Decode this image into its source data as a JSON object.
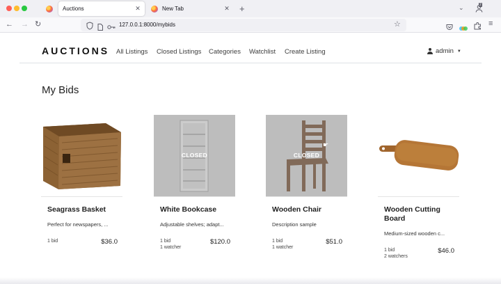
{
  "browser": {
    "tabs": [
      {
        "label": "Auctions",
        "active": true
      },
      {
        "label": "New Tab",
        "active": false
      }
    ],
    "tab_count_badge": "2",
    "url": "127.0.0.1:8000/mybids"
  },
  "site": {
    "brand": "AUCTIONS",
    "nav": [
      "All Listings",
      "Closed Listings",
      "Categories",
      "Watchlist",
      "Create Listing"
    ],
    "user": "admin"
  },
  "page_title": "My Bids",
  "closed_label": "CLOSED",
  "listings": [
    {
      "title": "Seagrass Basket",
      "description": "Perfect for newspapers, ...",
      "bids": "1 bid",
      "watchers": "",
      "price": "$36.0",
      "closed": false,
      "image_icon": "basket-icon"
    },
    {
      "title": "White Bookcase",
      "description": "Adjustable shelves; adapt...",
      "bids": "1 bid",
      "watchers": "1 watcher",
      "price": "$120.0",
      "closed": true,
      "image_icon": "bookcase-icon"
    },
    {
      "title": "Wooden Chair",
      "description": "Description sample",
      "bids": "1 bid",
      "watchers": "1 watcher",
      "price": "$51.0",
      "closed": true,
      "image_icon": "chair-icon"
    },
    {
      "title": "Wooden Cutting Board",
      "description": "Medium-sized wooden c...",
      "bids": "1 bid",
      "watchers": "2 watchers",
      "price": "$46.0",
      "closed": false,
      "image_icon": "cutting-board-icon"
    }
  ],
  "colors": {
    "closed_overlay": "#bdbdbd",
    "wood": "#8a5a2b",
    "basket": "#9a7040"
  }
}
